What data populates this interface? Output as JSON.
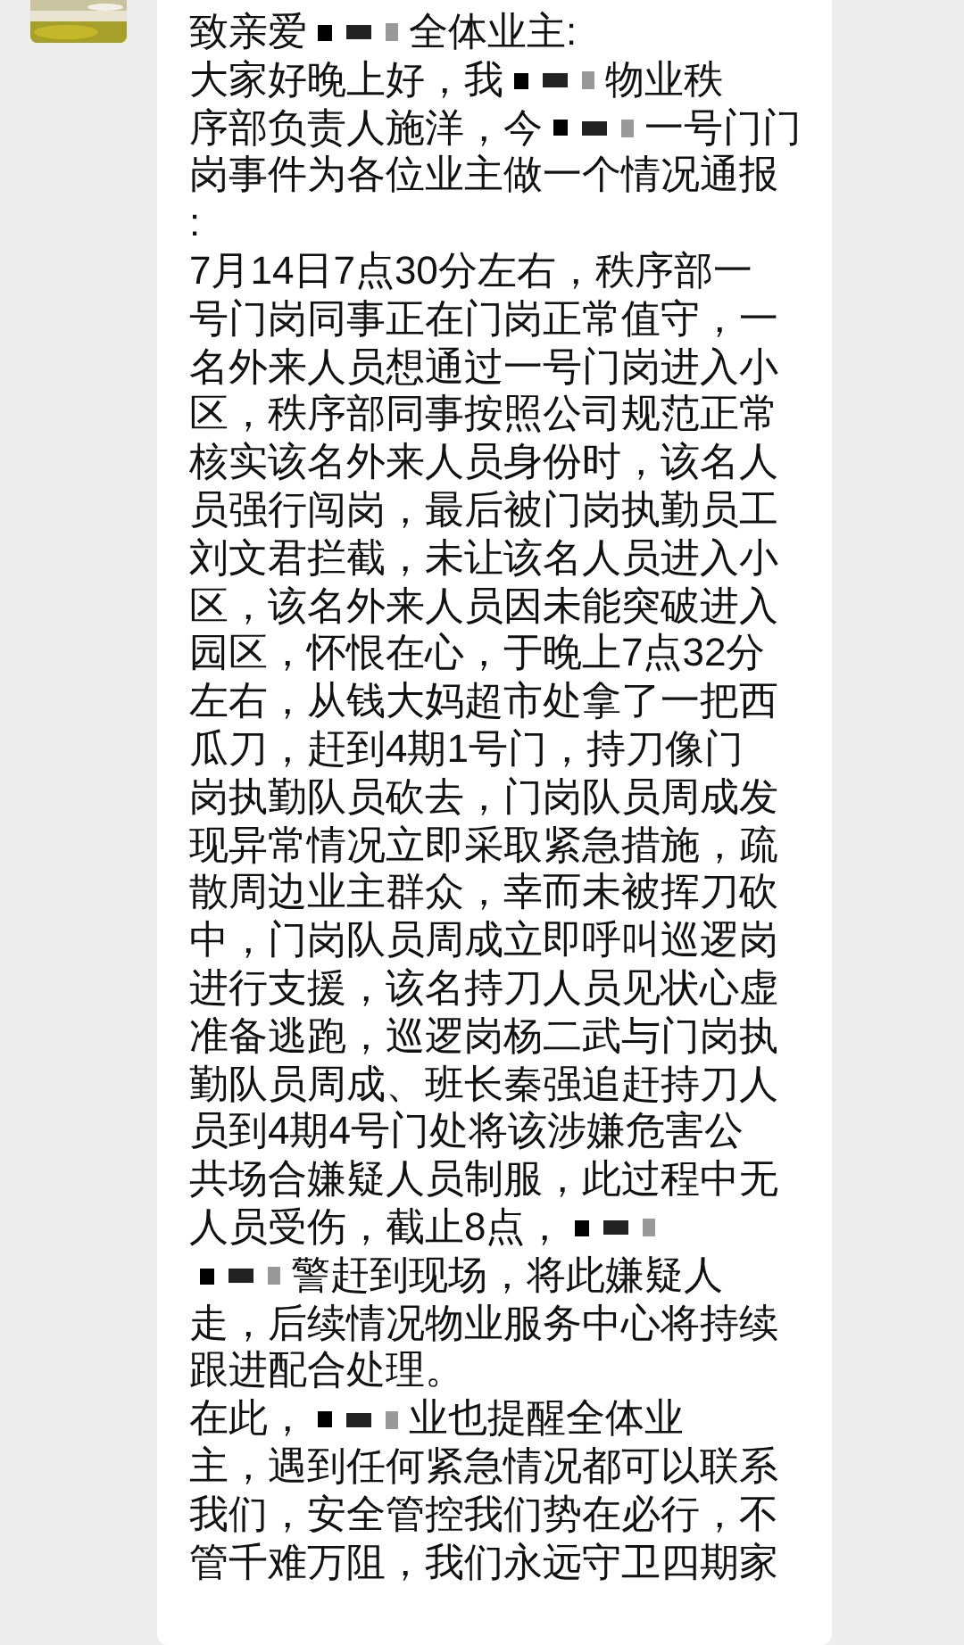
{
  "message": {
    "lines": [
      {
        "parts": [
          {
            "kind": "text",
            "text": "致亲爱"
          },
          {
            "kind": "redaction"
          },
          {
            "kind": "text",
            "text": "全体业主:"
          }
        ]
      },
      {
        "parts": [
          {
            "kind": "text",
            "text": "大家好晚上好，我"
          },
          {
            "kind": "redaction"
          },
          {
            "kind": "text",
            "text": "物业秩"
          }
        ]
      },
      {
        "parts": [
          {
            "kind": "text",
            "text": "序部负责人施洋，今"
          },
          {
            "kind": "redaction"
          },
          {
            "kind": "text",
            "text": "一号门门"
          }
        ]
      },
      {
        "parts": [
          {
            "kind": "text",
            "text": "岗事件为各位业主做一个情况通报"
          }
        ]
      },
      {
        "parts": [
          {
            "kind": "text",
            "text": ":"
          }
        ]
      },
      {
        "parts": [
          {
            "kind": "text",
            "text": "7月14日7点30分左右，秩序部一"
          }
        ]
      },
      {
        "parts": [
          {
            "kind": "text",
            "text": "号门岗同事正在门岗正常值守，一"
          }
        ]
      },
      {
        "parts": [
          {
            "kind": "text",
            "text": "名外来人员想通过一号门岗进入小"
          }
        ]
      },
      {
        "parts": [
          {
            "kind": "text",
            "text": "区，秩序部同事按照公司规范正常"
          }
        ]
      },
      {
        "parts": [
          {
            "kind": "text",
            "text": "核实该名外来人员身份时，该名人"
          }
        ]
      },
      {
        "parts": [
          {
            "kind": "text",
            "text": "员强行闯岗，最后被门岗执勤员工"
          }
        ]
      },
      {
        "parts": [
          {
            "kind": "text",
            "text": "刘文君拦截，未让该名人员进入小"
          }
        ]
      },
      {
        "parts": [
          {
            "kind": "text",
            "text": "区，该名外来人员因未能突破进入"
          }
        ]
      },
      {
        "parts": [
          {
            "kind": "text",
            "text": "园区，怀恨在心，于晚上7点32分"
          }
        ]
      },
      {
        "parts": [
          {
            "kind": "text",
            "text": "左右，从钱大妈超市处拿了一把西"
          }
        ]
      },
      {
        "parts": [
          {
            "kind": "text",
            "text": "瓜刀，赶到4期1号门，持刀像门"
          }
        ]
      },
      {
        "parts": [
          {
            "kind": "text",
            "text": "岗执勤队员砍去，门岗队员周成发"
          }
        ]
      },
      {
        "parts": [
          {
            "kind": "text",
            "text": "现异常情况立即采取紧急措施，疏"
          }
        ]
      },
      {
        "parts": [
          {
            "kind": "text",
            "text": "散周边业主群众，幸而未被挥刀砍"
          }
        ]
      },
      {
        "parts": [
          {
            "kind": "text",
            "text": "中，门岗队员周成立即呼叫巡逻岗"
          }
        ]
      },
      {
        "parts": [
          {
            "kind": "text",
            "text": "进行支援，该名持刀人员见状心虚"
          }
        ]
      },
      {
        "parts": [
          {
            "kind": "text",
            "text": "准备逃跑，巡逻岗杨二武与门岗执"
          }
        ]
      },
      {
        "parts": [
          {
            "kind": "text",
            "text": "勤队员周成、班长秦强追赶持刀人"
          }
        ]
      },
      {
        "parts": [
          {
            "kind": "text",
            "text": "员到4期4号门处将该涉嫌危害公"
          }
        ]
      },
      {
        "parts": [
          {
            "kind": "text",
            "text": "共场合嫌疑人员制服，此过程中无"
          }
        ]
      },
      {
        "parts": [
          {
            "kind": "text",
            "text": "人员受伤，截止8点，"
          },
          {
            "kind": "redaction"
          }
        ]
      },
      {
        "parts": [
          {
            "kind": "redaction"
          },
          {
            "kind": "text",
            "text": "警赶到现场，将此嫌疑人"
          }
        ]
      },
      {
        "parts": [
          {
            "kind": "text",
            "text": "走，后续情况物业服务中心将持续"
          }
        ]
      },
      {
        "parts": [
          {
            "kind": "text",
            "text": "跟进配合处理。"
          }
        ]
      },
      {
        "parts": [
          {
            "kind": "text",
            "text": "在此，"
          },
          {
            "kind": "redaction"
          },
          {
            "kind": "text",
            "text": "业也提醒全体业"
          }
        ]
      },
      {
        "parts": [
          {
            "kind": "text",
            "text": "主，遇到任何紧急情况都可以联系"
          }
        ]
      },
      {
        "parts": [
          {
            "kind": "text",
            "text": "我们，安全管控我们势在必行，不"
          }
        ]
      },
      {
        "parts": [
          {
            "kind": "text",
            "text": "管千难万阻，我们永远守卫四期家"
          }
        ]
      }
    ]
  }
}
